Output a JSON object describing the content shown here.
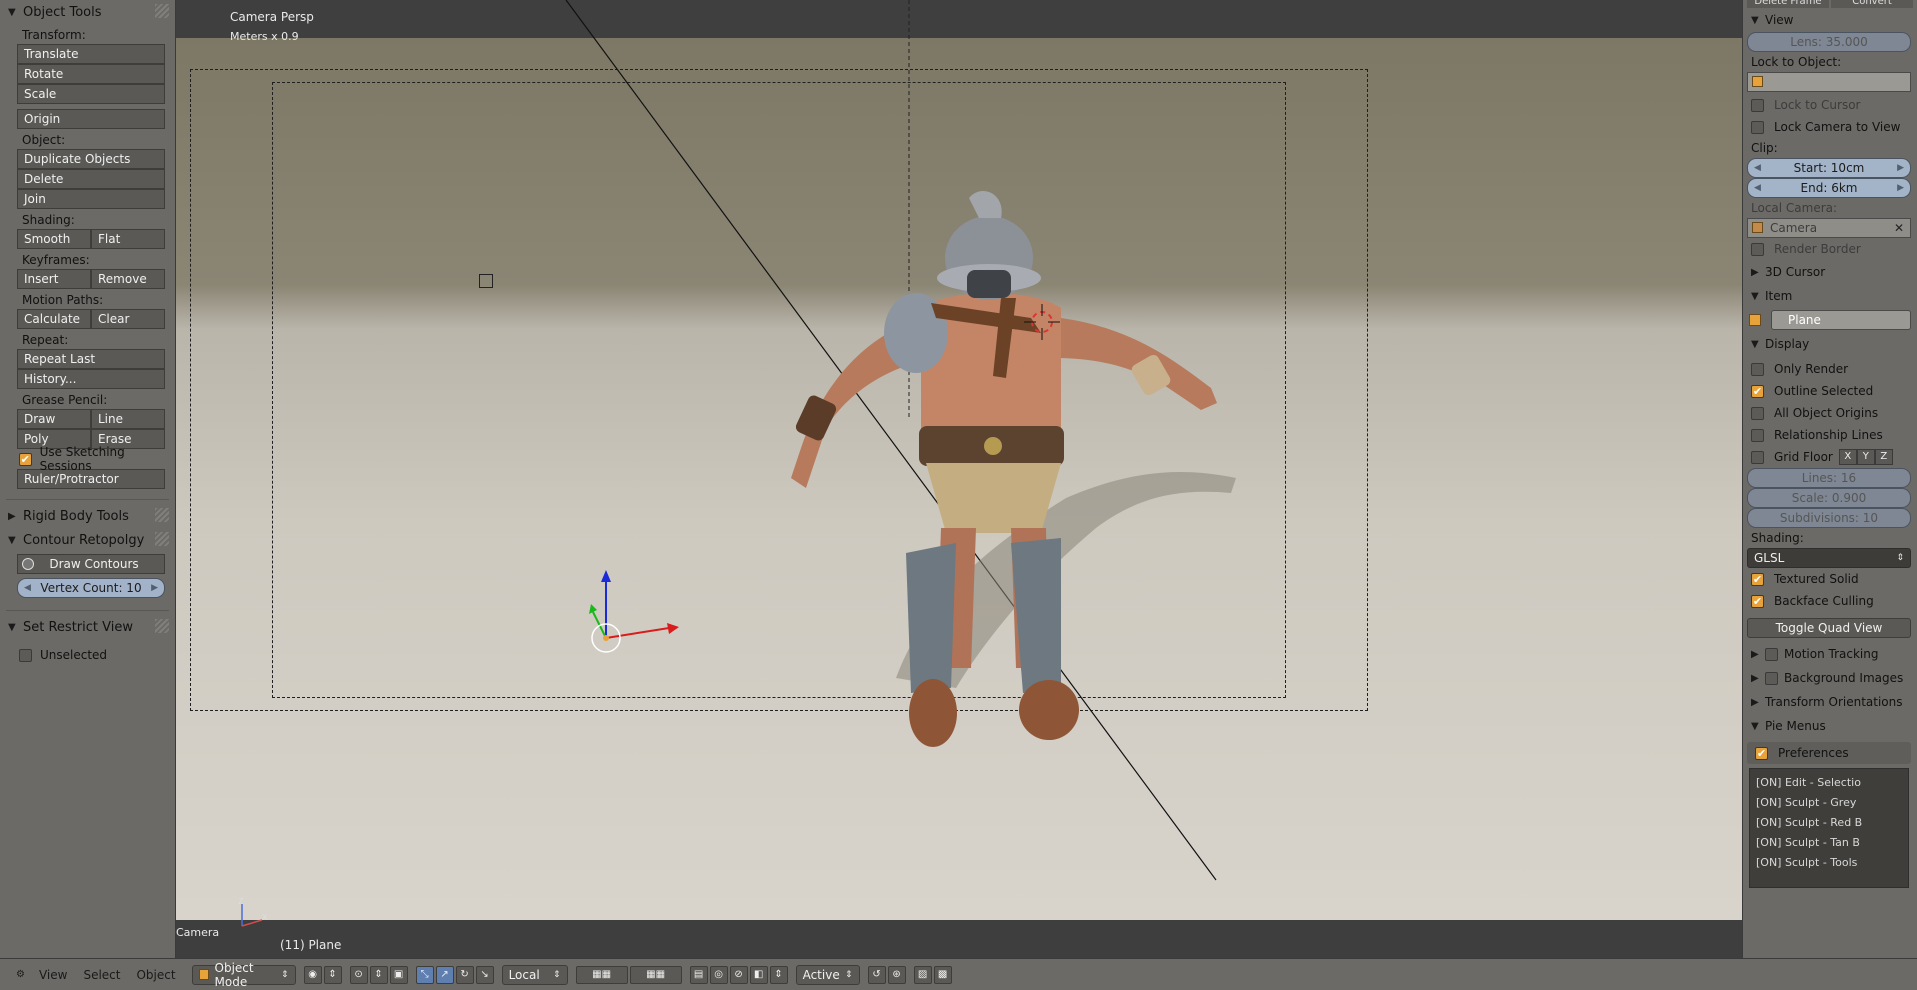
{
  "left_panel": {
    "header": "Object Tools",
    "transform": {
      "label": "Transform:",
      "translate": "Translate",
      "rotate": "Rotate",
      "scale": "Scale"
    },
    "origin": "Origin",
    "object": {
      "label": "Object:",
      "duplicate": "Duplicate Objects",
      "delete": "Delete",
      "join": "Join"
    },
    "shading": {
      "label": "Shading:",
      "smooth": "Smooth",
      "flat": "Flat"
    },
    "keyframes": {
      "label": "Keyframes:",
      "insert": "Insert",
      "remove": "Remove"
    },
    "motion_paths": {
      "label": "Motion Paths:",
      "calculate": "Calculate",
      "clear": "Clear"
    },
    "repeat": {
      "label": "Repeat:",
      "repeat_last": "Repeat Last",
      "history": "History..."
    },
    "grease_pencil": {
      "label": "Grease Pencil:",
      "draw": "Draw",
      "line": "Line",
      "poly": "Poly",
      "erase": "Erase",
      "use_sketching": "Use Sketching Sessions",
      "ruler": "Ruler/Protractor"
    },
    "rigid_body_tools": "Rigid Body Tools",
    "contour_retopology": {
      "header": "Contour Retopolgy",
      "draw_contours": "Draw Contours",
      "vertex_count": "Vertex Count: 10"
    },
    "set_restrict_view": {
      "header": "Set Restrict View",
      "unselected": "Unselected"
    }
  },
  "viewport": {
    "view_name": "Camera Persp",
    "units": "Meters x 0.9",
    "camera_label": "Camera",
    "object_info": "(11) Plane"
  },
  "right_panel": {
    "top_cut": {
      "delete_frame": "Delete Frame",
      "convert": "Convert"
    },
    "view": {
      "header": "View",
      "lens": "Lens: 35.000",
      "lock_to_object": "Lock to Object:",
      "lock_to_cursor": "Lock to Cursor",
      "lock_camera": "Lock Camera to View",
      "clip": "Clip:",
      "clip_start": "Start: 10cm",
      "clip_end": "End: 6km",
      "local_camera": "Local Camera:",
      "local_camera_value": "Camera",
      "render_border": "Render Border"
    },
    "cursor_3d": "3D Cursor",
    "item": {
      "header": "Item",
      "name": "Plane"
    },
    "display": {
      "header": "Display",
      "only_render": "Only Render",
      "outline_selected": "Outline Selected",
      "all_object_origins": "All Object Origins",
      "relationship_lines": "Relationship Lines",
      "grid_floor": "Grid Floor",
      "axis_x": "X",
      "axis_y": "Y",
      "axis_z": "Z",
      "lines": "Lines: 16",
      "scale": "Scale: 0.900",
      "subdivisions": "Subdivisions: 10",
      "shading_label": "Shading:",
      "shading_value": "GLSL",
      "textured_solid": "Textured Solid",
      "backface_culling": "Backface Culling",
      "toggle_quad": "Toggle Quad View"
    },
    "motion_tracking": "Motion Tracking",
    "background_images": "Background Images",
    "transform_orientations": "Transform Orientations",
    "pie_menus": {
      "header": "Pie Menus",
      "preferences": "Preferences",
      "items": [
        "[ON] Edit - Selectio",
        "[ON] Sculpt - Grey",
        "[ON] Sculpt - Red B",
        "[ON] Sculpt - Tan B",
        "[ON] Sculpt - Tools"
      ]
    }
  },
  "bottom_bar": {
    "view": "View",
    "select": "Select",
    "object": "Object",
    "mode": "Object Mode",
    "orientation": "Local",
    "pivot_mode": "Active"
  },
  "colors": {
    "accent_checkbox": "#e8a23a",
    "field_blue": "#a3b3c8",
    "panel_bg": "#6c6a66"
  }
}
